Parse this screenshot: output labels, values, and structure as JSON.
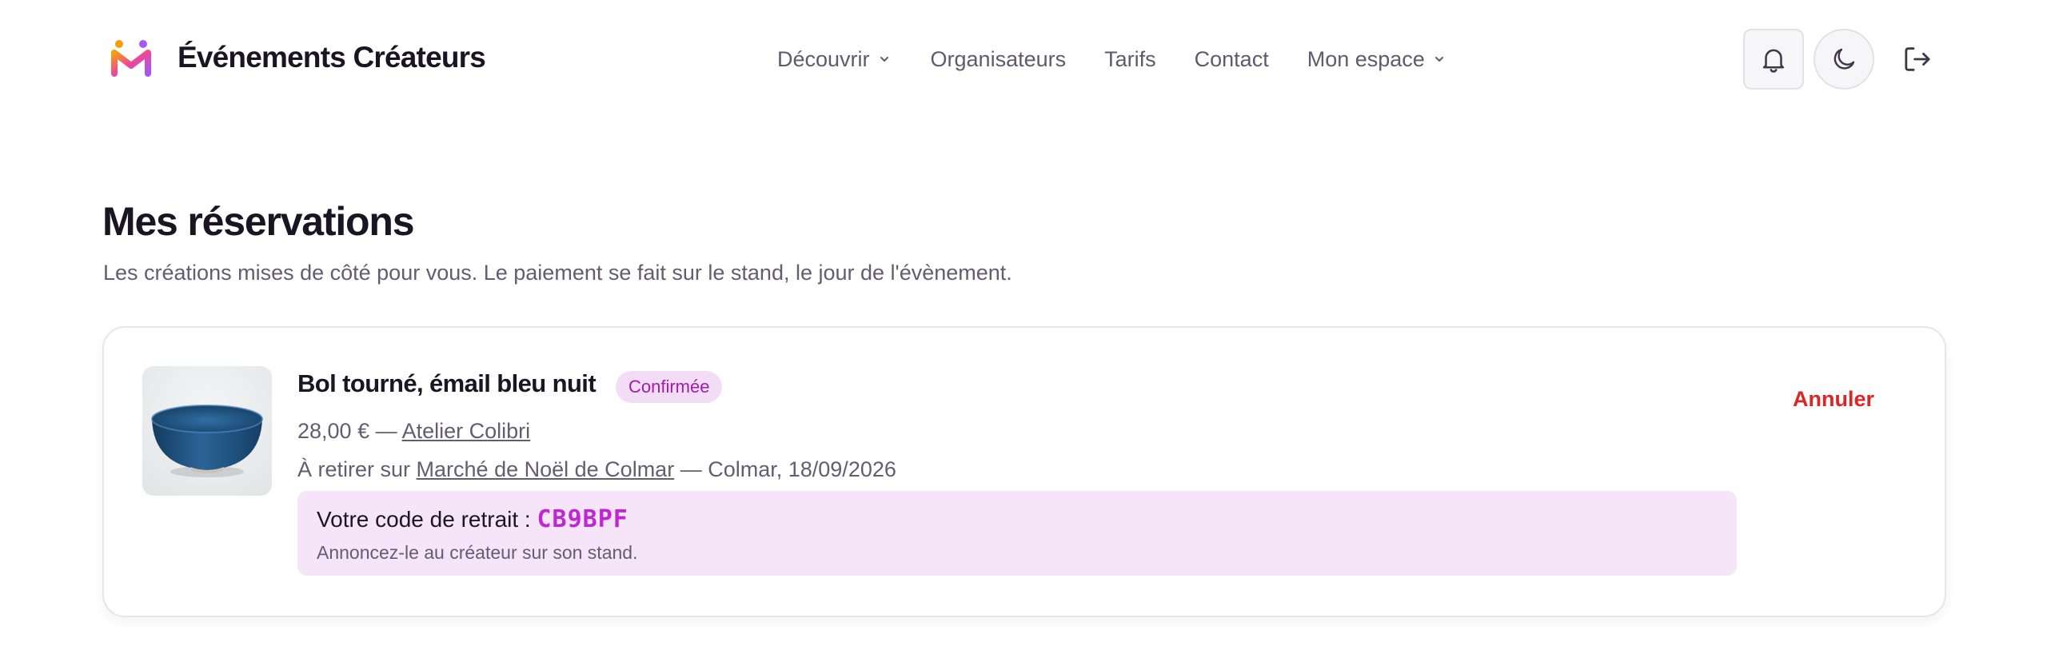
{
  "brand": {
    "name": "Événements Créateurs"
  },
  "nav": {
    "items": [
      {
        "label": "Découvrir",
        "has_dropdown": true
      },
      {
        "label": "Organisateurs",
        "has_dropdown": false
      },
      {
        "label": "Tarifs",
        "has_dropdown": false
      },
      {
        "label": "Contact",
        "has_dropdown": false
      },
      {
        "label": "Mon espace",
        "has_dropdown": true
      }
    ]
  },
  "header_actions": {
    "notifications_icon": "bell-icon",
    "theme_icon": "moon-icon",
    "logout_icon": "logout-icon"
  },
  "page": {
    "title": "Mes réservations",
    "subtitle": "Les créations mises de côté pour vous. Le paiement se fait sur le stand, le jour de l'évènement."
  },
  "reservations": [
    {
      "title": "Bol tourné, émail bleu nuit",
      "status": "Confirmée",
      "price": "28,00 €",
      "separator": "—",
      "maker": "Atelier Colibri",
      "pickup_prefix": "À retirer sur",
      "event": "Marché de Noël de Colmar",
      "event_suffix": "— Colmar, 18/09/2026",
      "code_label": "Votre code de retrait :",
      "code": "CB9BPF",
      "code_hint": "Annoncez-le au créateur sur son stand.",
      "cancel_label": "Annuler"
    }
  ],
  "colors": {
    "accent": "#c026d3",
    "badge_bg": "#f3dcf6",
    "code_bg": "#f6e4f8",
    "danger": "#dc2626",
    "bowl": "#1e4e7a"
  }
}
